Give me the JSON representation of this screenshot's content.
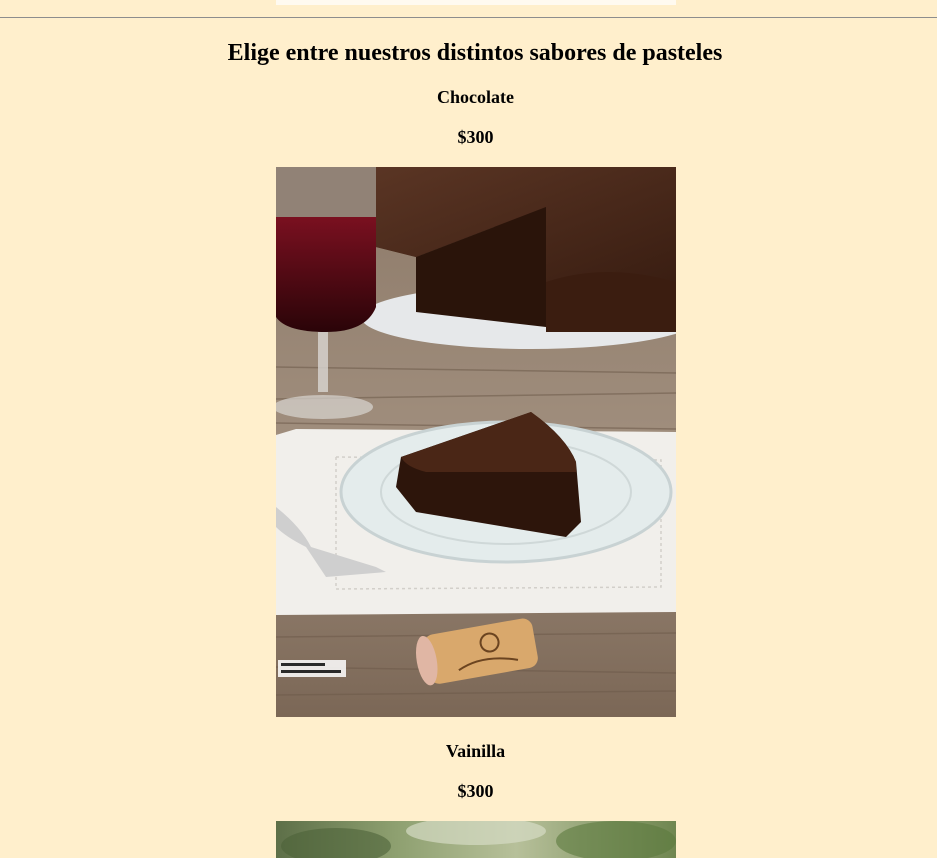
{
  "header": {
    "title": "Elige entre nuestros distintos sabores de pasteles"
  },
  "flavors": [
    {
      "name": "Chocolate",
      "price": "$300",
      "image_alt": "Pastel de chocolate",
      "photo_caption": "Liliana Fuchs Directo al Paladar"
    },
    {
      "name": "Vainilla",
      "price": "$300",
      "image_alt": "Pastel de vainilla"
    }
  ],
  "colors": {
    "background": "#ffefcc",
    "rule": "#8d8d8d"
  }
}
